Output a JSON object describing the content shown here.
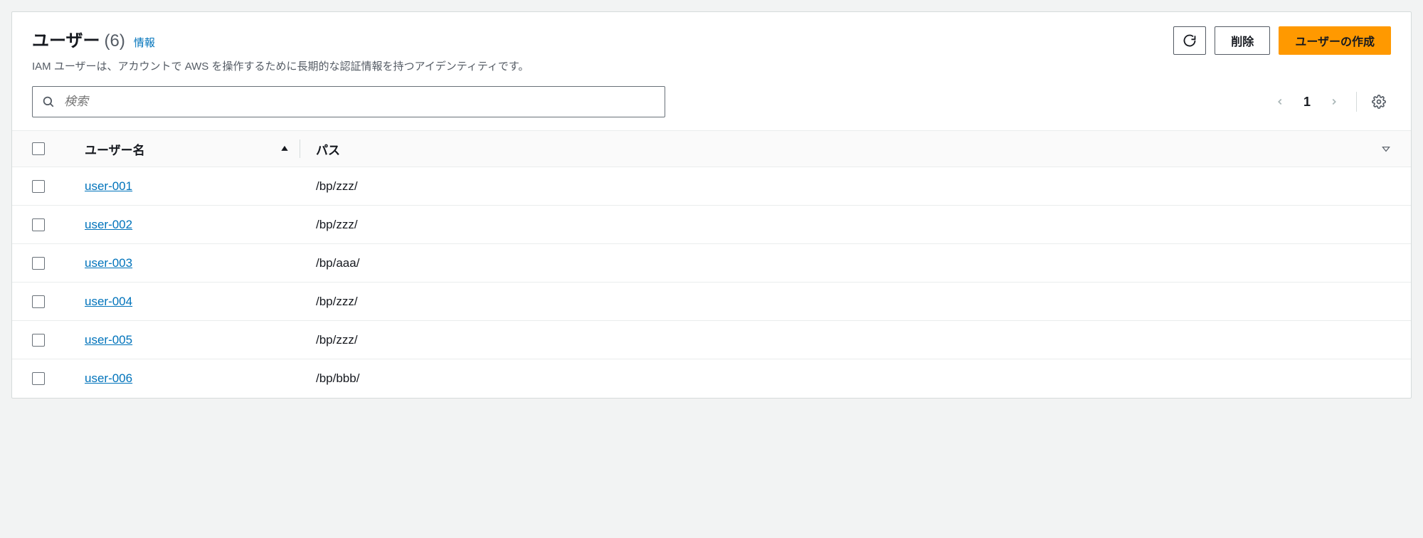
{
  "header": {
    "title": "ユーザー",
    "count": "(6)",
    "info_link": "情報",
    "description": "IAM ユーザーは、アカウントで AWS を操作するために長期的な認証情報を持つアイデンティティです。",
    "refresh_label": "",
    "delete_label": "削除",
    "create_label": "ユーザーの作成"
  },
  "search": {
    "placeholder": "検索"
  },
  "pagination": {
    "page": "1"
  },
  "table": {
    "columns": {
      "username": "ユーザー名",
      "path": "パス"
    },
    "rows": [
      {
        "username": "user-001",
        "path": "/bp/zzz/"
      },
      {
        "username": "user-002",
        "path": "/bp/zzz/"
      },
      {
        "username": "user-003",
        "path": "/bp/aaa/"
      },
      {
        "username": "user-004",
        "path": "/bp/zzz/"
      },
      {
        "username": "user-005",
        "path": "/bp/zzz/"
      },
      {
        "username": "user-006",
        "path": "/bp/bbb/"
      }
    ]
  }
}
